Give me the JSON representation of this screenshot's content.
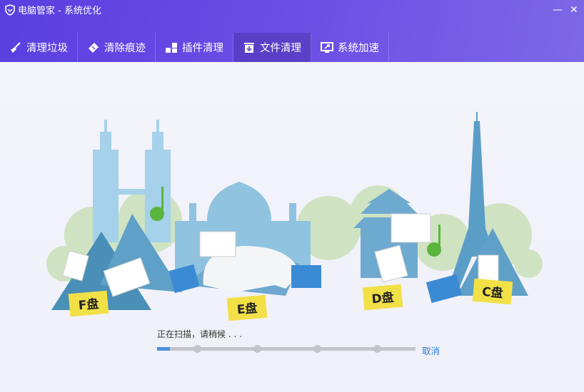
{
  "window": {
    "title": "电脑管家 - 系统优化",
    "minimize": "—",
    "close": "✕"
  },
  "tabs": [
    {
      "label": "清理垃圾",
      "icon": "broom-icon"
    },
    {
      "label": "清除痕迹",
      "icon": "eraser-icon"
    },
    {
      "label": "插件清理",
      "icon": "puzzle-icon"
    },
    {
      "label": "文件清理",
      "icon": "file-download-icon",
      "active": true
    },
    {
      "label": "系统加速",
      "icon": "monitor-boost-icon"
    }
  ],
  "illustration": {
    "disks": [
      "F盘",
      "E盘",
      "D盘",
      "C盘"
    ]
  },
  "scan": {
    "status": "正在扫描，请稍候 . . .",
    "progress_percent": 5,
    "cancel": "取消"
  },
  "colors": {
    "accent": "#5a3fe0",
    "progress": "#4a8fe0",
    "link": "#2a7de0"
  }
}
